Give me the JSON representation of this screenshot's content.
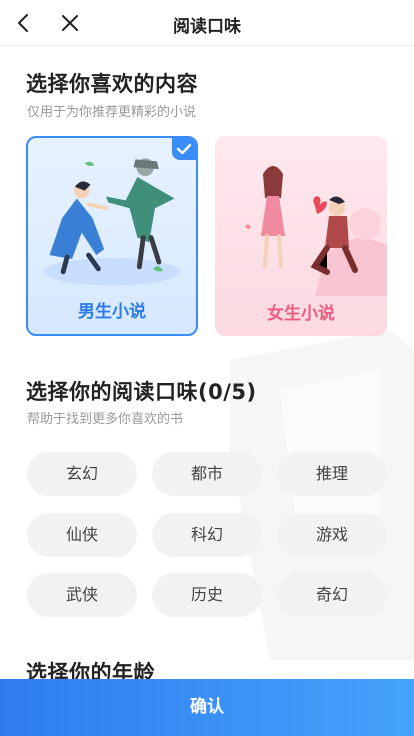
{
  "header": {
    "title": "阅读口味"
  },
  "content_section": {
    "title": "选择你喜欢的内容",
    "subtitle": "仅用于为你推荐更精彩的小说"
  },
  "cards": [
    {
      "label": "男生小说",
      "selected": true
    },
    {
      "label": "女生小说",
      "selected": false
    }
  ],
  "taste_section": {
    "title": "选择你的阅读口味(0/5)",
    "subtitle": "帮助于找到更多你喜欢的书"
  },
  "tags": [
    "玄幻",
    "都市",
    "推理",
    "仙侠",
    "科幻",
    "游戏",
    "武侠",
    "历史",
    "奇幻"
  ],
  "age_section": {
    "title": "选择你的年龄"
  },
  "confirm_button": {
    "label": "确认"
  },
  "colors": {
    "accent": "#3a8cf6",
    "male_label": "#2d7be6",
    "female_label": "#ee5a80",
    "chip_bg": "#f2f2f2"
  }
}
